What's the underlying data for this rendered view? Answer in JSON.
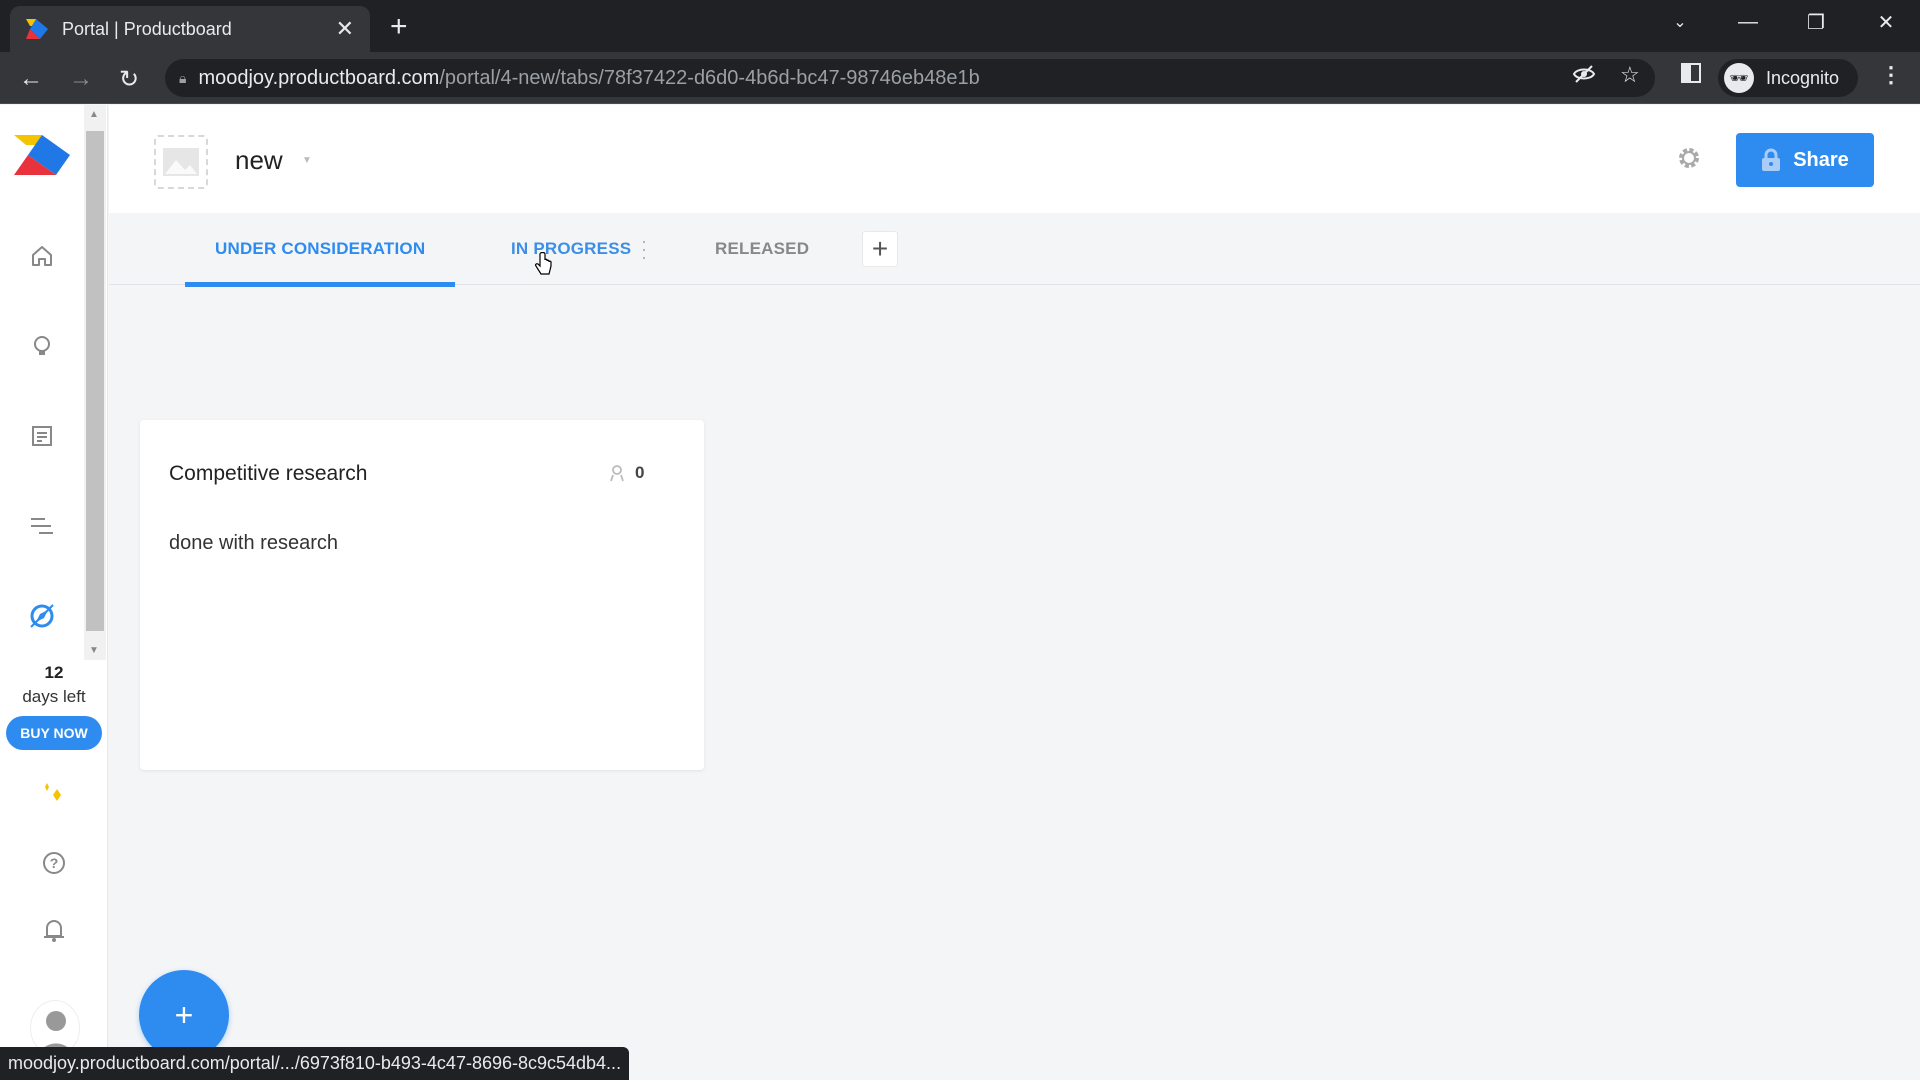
{
  "browser": {
    "tab_title": "Portal | Productboard",
    "url_host": "moodjoy.productboard.com",
    "url_path": "/portal/4-new/tabs/78f37422-d6d0-4b6d-bc47-98746eb48e1b",
    "profile_label": "Incognito",
    "status_url": "moodjoy.productboard.com/portal/.../6973f810-b493-4c47-8696-8c9c54db4..."
  },
  "sidebar": {
    "items": [
      {
        "icon": "home-icon",
        "label": "Home"
      },
      {
        "icon": "lightbulb-icon",
        "label": "Insights"
      },
      {
        "icon": "notes-icon",
        "label": "Features"
      },
      {
        "icon": "roadmap-icon",
        "label": "Roadmaps"
      },
      {
        "icon": "compass-icon",
        "label": "Portal"
      }
    ],
    "trial_days": "12",
    "trial_label": "days left",
    "buy_now": "BUY NOW"
  },
  "header": {
    "portal_name": "new",
    "share_label": "Share"
  },
  "tabs": [
    {
      "label": "UNDER CONSIDERATION",
      "active": true
    },
    {
      "label": "IN PROGRESS",
      "active": false
    },
    {
      "label": "RELEASED",
      "active": false
    }
  ],
  "cards": [
    {
      "title": "Competitive research",
      "votes": "0",
      "description": "done with research"
    }
  ],
  "colors": {
    "accent": "#2e8cf0",
    "logo_yellow": "#f5c400",
    "logo_red": "#e8323c",
    "logo_blue": "#1f78e6"
  }
}
